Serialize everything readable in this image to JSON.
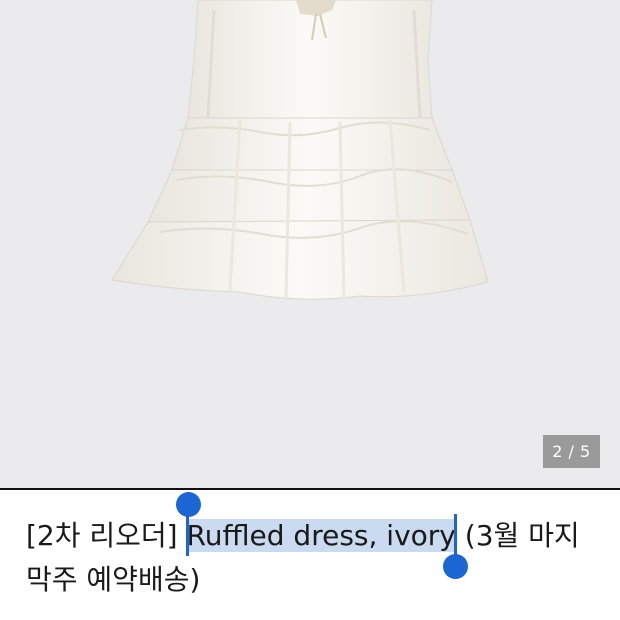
{
  "gallery": {
    "image_alt": "Ruffled dress, ivory",
    "page_indicator": "2 / 5",
    "background": "#ebebed"
  },
  "product": {
    "title_prefix": "[2차 리오더] ",
    "title_selected": "Ruffled dress, ivory",
    "title_suffix_line1": " (3월 마지",
    "title_line2": "막주 예약배송)"
  },
  "selection": {
    "highlight_color": "#c9daf1",
    "handle_color": "#1b66d2"
  }
}
